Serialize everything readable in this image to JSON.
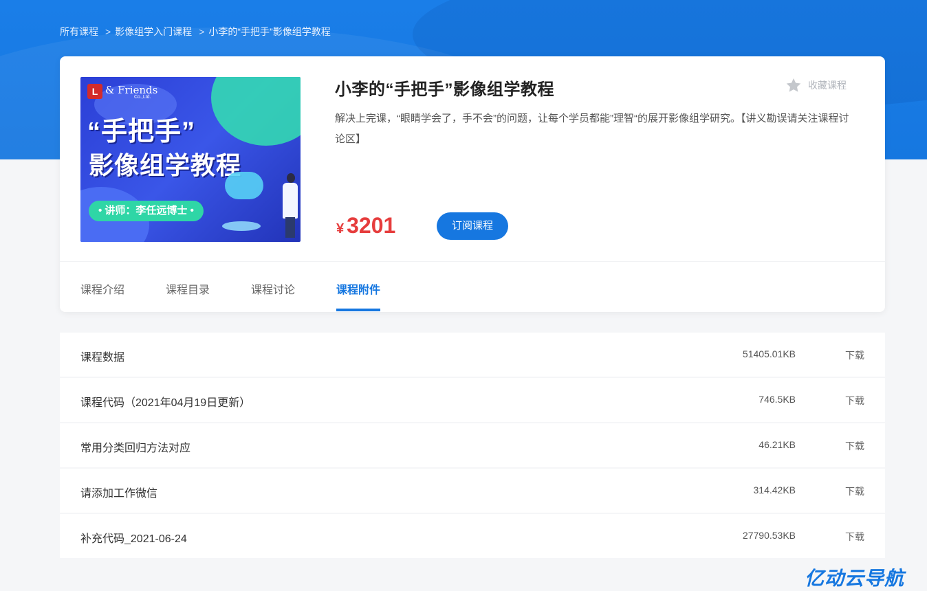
{
  "breadcrumb": [
    "所有课程",
    "影像组学入门课程",
    "小李的“手把手”影像组学教程"
  ],
  "breadcrumb_sep": ">",
  "cover": {
    "logo_letter": "L",
    "logo_text": "& Friends",
    "logo_sub": "Co.,Ltd.",
    "title_line1": "“手把手”",
    "title_line2": "影像组学教程",
    "teacher": "• 讲师：李任远博士 •"
  },
  "course": {
    "title": "小李的“手把手”影像组学教程",
    "favorite_label": "收藏课程",
    "description": "解决上完课，“眼睛学会了，手不会”的问题，让每个学员都能”理智“的展开影像组学研究。【讲义勘误请关注课程讨论区】",
    "currency": "¥",
    "price": "3201",
    "subscribe_label": "订阅课程"
  },
  "tabs": [
    {
      "label": "课程介绍",
      "active": false
    },
    {
      "label": "课程目录",
      "active": false
    },
    {
      "label": "课程讨论",
      "active": false
    },
    {
      "label": "课程附件",
      "active": true
    }
  ],
  "attachments": [
    {
      "name": "课程数据",
      "size": "51405.01KB",
      "action": "下载"
    },
    {
      "name": "课程代码（2021年04月19日更新）",
      "size": "746.5KB",
      "action": "下载"
    },
    {
      "name": "常用分类回归方法对应",
      "size": "46.21KB",
      "action": "下载"
    },
    {
      "name": "请添加工作微信",
      "size": "314.42KB",
      "action": "下载"
    },
    {
      "name": "补充代码_2021-06-24",
      "size": "27790.53KB",
      "action": "下载"
    }
  ],
  "watermark": "亿动云导航",
  "colors": {
    "primary": "#1677e0",
    "price": "#e63d3d",
    "background": "#f5f6f8"
  },
  "icons": {
    "favorite": "star-icon"
  }
}
